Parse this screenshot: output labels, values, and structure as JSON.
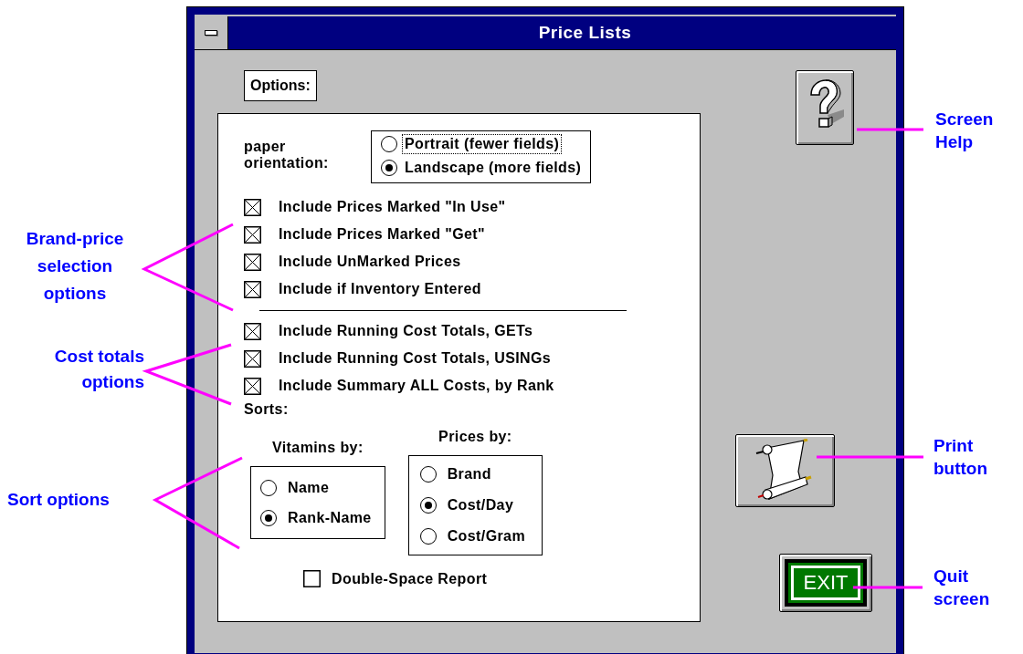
{
  "window": {
    "title": "Price Lists"
  },
  "options_label": "Options:",
  "paper_orientation": {
    "label": "paper\norientation:",
    "options": [
      {
        "label": "Portrait (fewer fields)",
        "selected": false,
        "focused": true
      },
      {
        "label": "Landscape (more fields)",
        "selected": true,
        "focused": false
      }
    ]
  },
  "selection_options": [
    {
      "label": "Include Prices Marked \"In Use\"",
      "checked": true
    },
    {
      "label": "Include Prices Marked \"Get\"",
      "checked": true
    },
    {
      "label": "Include UnMarked Prices",
      "checked": true
    },
    {
      "label": "Include if Inventory Entered",
      "checked": true
    }
  ],
  "cost_options": [
    {
      "label": "Include Running Cost Totals, GETs",
      "checked": true
    },
    {
      "label": "Include Running Cost Totals, USINGs",
      "checked": true
    },
    {
      "label": "Include Summary ALL Costs, by Rank",
      "checked": true
    }
  ],
  "sorts": {
    "label": "Sorts:",
    "vitamins": {
      "label": "Vitamins by:",
      "options": [
        {
          "label": "Name",
          "selected": false
        },
        {
          "label": "Rank-Name",
          "selected": true
        }
      ]
    },
    "prices": {
      "label": "Prices by:",
      "options": [
        {
          "label": "Brand",
          "selected": false
        },
        {
          "label": "Cost/Day",
          "selected": true
        },
        {
          "label": "Cost/Gram",
          "selected": false
        }
      ]
    }
  },
  "double_space": {
    "label": "Double-Space Report",
    "checked": false
  },
  "buttons": [
    {
      "kind": "help"
    },
    {
      "kind": "print"
    },
    {
      "kind": "exit",
      "label": "EXIT"
    }
  ],
  "annotations": [
    {
      "text": "Brand-price\nselection\noptions"
    },
    {
      "text": "Cost totals\noptions"
    },
    {
      "text": "Sort options"
    },
    {
      "text": "Screen\nHelp"
    },
    {
      "text": "Print\nbutton"
    },
    {
      "text": "Quit\nscreen"
    }
  ]
}
